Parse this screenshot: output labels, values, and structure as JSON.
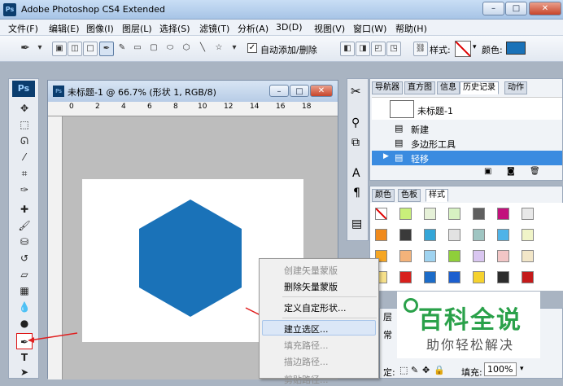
{
  "app": {
    "title": "Adobe Photoshop CS4 Extended",
    "logo": "Ps",
    "window_buttons": [
      "–",
      "□",
      "✕"
    ]
  },
  "menu": [
    "文件(F)",
    "编辑(E)",
    "图像(I)",
    "图层(L)",
    "选择(S)",
    "滤镜(T)",
    "分析(A)",
    "3D(D)",
    "视图(V)",
    "窗口(W)",
    "帮助(H)"
  ],
  "options": {
    "auto_add_delete_label": "自动添加/删除",
    "auto_add_delete_checked": true,
    "style_label": "样式:",
    "color_label": "颜色:",
    "color_value": "#1a72b8"
  },
  "toolbox": {
    "logo": "Ps",
    "tools": [
      "move-tool-icon",
      "marquee-tool-icon",
      "lasso-tool-icon",
      "quick-select-tool-icon",
      "crop-tool-icon",
      "eyedropper-tool-icon",
      "healing-brush-icon",
      "brush-tool-icon",
      "clone-stamp-icon",
      "history-brush-icon",
      "eraser-tool-icon",
      "gradient-tool-icon",
      "blur-tool-icon",
      "dodge-tool-icon",
      "pen-tool-icon",
      "type-tool-icon",
      "path-select-tool-icon"
    ],
    "type_tool_glyph": "T"
  },
  "document": {
    "title": "未标题-1 @ 66.7% (形状 1, RGB/8)",
    "shape_color": "#1a72b8",
    "ruler_labels": [
      "0",
      "2",
      "4",
      "6",
      "8",
      "10",
      "12",
      "14",
      "16",
      "18"
    ]
  },
  "context_menu": {
    "items": [
      {
        "label": "创建矢量蒙版",
        "disabled": true
      },
      {
        "label": "删除矢量蒙版",
        "disabled": false
      },
      {
        "label": "定义自定形状...",
        "disabled": false
      },
      {
        "label": "建立选区...",
        "disabled": false,
        "highlighted": true
      },
      {
        "label": "填充路径...",
        "disabled": true
      },
      {
        "label": "描边路径...",
        "disabled": true
      },
      {
        "label": "剪贴路径...",
        "disabled": true
      }
    ]
  },
  "history_panel": {
    "tabs": [
      "导航器",
      "直方图",
      "信息",
      "历史记录",
      "动作"
    ],
    "active_tab": "历史记录",
    "snapshot_label": "未标题-1",
    "items": [
      {
        "label": "新建",
        "selected": false
      },
      {
        "label": "多边形工具",
        "selected": false
      },
      {
        "label": "轻移",
        "selected": true
      }
    ]
  },
  "styles_panel": {
    "tabs": [
      "颜色",
      "色板",
      "样式"
    ],
    "active_tab": "样式",
    "swatches": [
      [
        "#ffffff",
        "#c9f07a",
        "#e6f1d8",
        "#d7f2c2",
        "#5f5f5f",
        "#c2127c",
        "#e8e8e8"
      ],
      [
        "#f08a1c",
        "#3a3a3a",
        "#34a6d8",
        "#e2e2e2",
        "#9fc5c2",
        "#4fb3e8",
        "#f0f4c8"
      ],
      [
        "#f6a623",
        "#f4b37a",
        "#9fd3f0",
        "#8fcf3a",
        "#d9c6f0",
        "#f2c6c6",
        "#f2e6c8"
      ],
      [
        "#f6e08a",
        "#d8201c",
        "#1c6cc8",
        "#1c5fcf",
        "#f5d22e",
        "#2c2c2c",
        "#c41a1a"
      ]
    ]
  },
  "layers_panel": {
    "tab_label": "层",
    "mode_label": "常",
    "lock_label": "定:",
    "fill_label": "填充:",
    "fill_value": "100%"
  },
  "watermark": {
    "title": "百科全说",
    "subtitle": "助你轻松解决"
  }
}
